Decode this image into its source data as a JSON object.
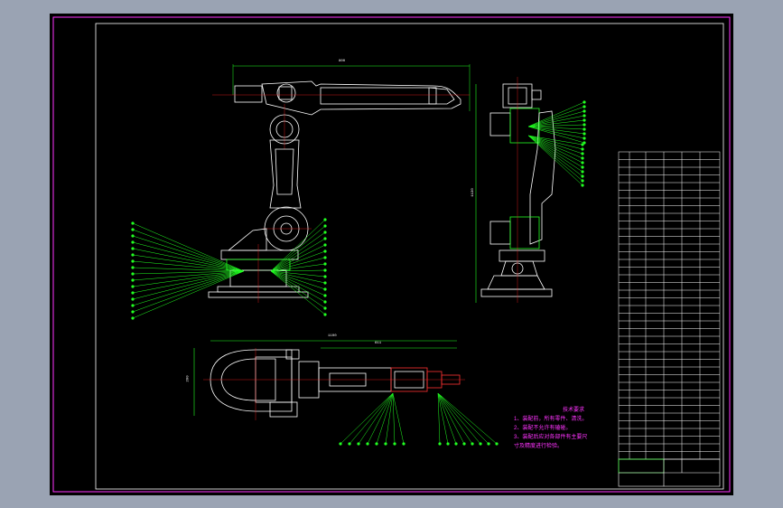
{
  "notes": {
    "title": "技术要求",
    "lines": [
      "1、装配前，所有零件、清洗。",
      "2、装配不允许有磕碰。",
      "3、装配后应对各部件有主要尺",
      "寸及精度进行检验。"
    ]
  },
  "dimensions": {
    "top_width": "800",
    "side_height": "1130",
    "bottom_width_outer": "1100",
    "bottom_width_inner": "611",
    "bottom_height": "200"
  },
  "colors": {
    "frame": "#ff33ff",
    "line": "#ffffff",
    "leader": "#22ff22",
    "center": "#ff2222",
    "annotation": "#ff33ff"
  }
}
